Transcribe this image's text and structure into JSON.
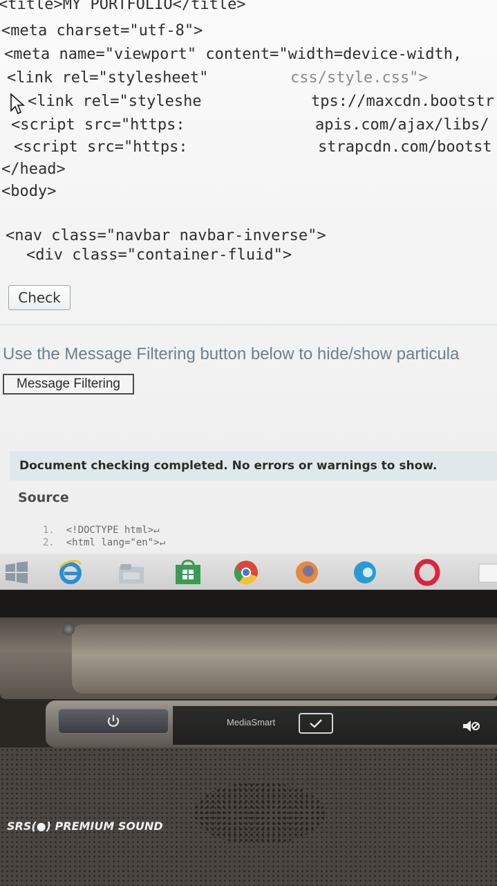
{
  "code_editor": {
    "lines": [
      "<title>MY PORTFOLIO</title>",
      "<meta charset=\"utf-8\">",
      "<meta name=\"viewport\" content=\"width=device-width,",
      "<link rel=\"stylesheet\"",
      "css/style.css\">",
      "<link rel=\"styleshe",
      "tps://maxcdn.bootstr",
      "<script src=\"https:",
      "apis.com/ajax/libs/",
      "<script src=\"https:",
      "strapcdn.com/bootst",
      "</head>",
      "<body>",
      "<nav class=\"navbar navbar-inverse\">",
      "<div class=\"container-fluid\">"
    ]
  },
  "check_button": {
    "label": "Check"
  },
  "message_filtering": {
    "description": "Use the Message Filtering button below to hide/show particula",
    "button_label": "Message Filtering"
  },
  "status": {
    "message": "Document checking completed. No errors or warnings to show."
  },
  "source": {
    "title": "Source",
    "lines": [
      {
        "number": "1.",
        "code": "<!DOCTYPE html>↵"
      },
      {
        "number": "2.",
        "code": "<html lang=\"en\">↵"
      }
    ]
  },
  "taskbar": {
    "items": [
      "windows-start",
      "internet-explorer",
      "file-explorer",
      "store",
      "chrome",
      "firefox",
      "edge",
      "opera",
      "window"
    ]
  },
  "laptop": {
    "media_label": "MediaSmart",
    "brand_logo": "SRS(●) PREMIUM SOUND"
  }
}
